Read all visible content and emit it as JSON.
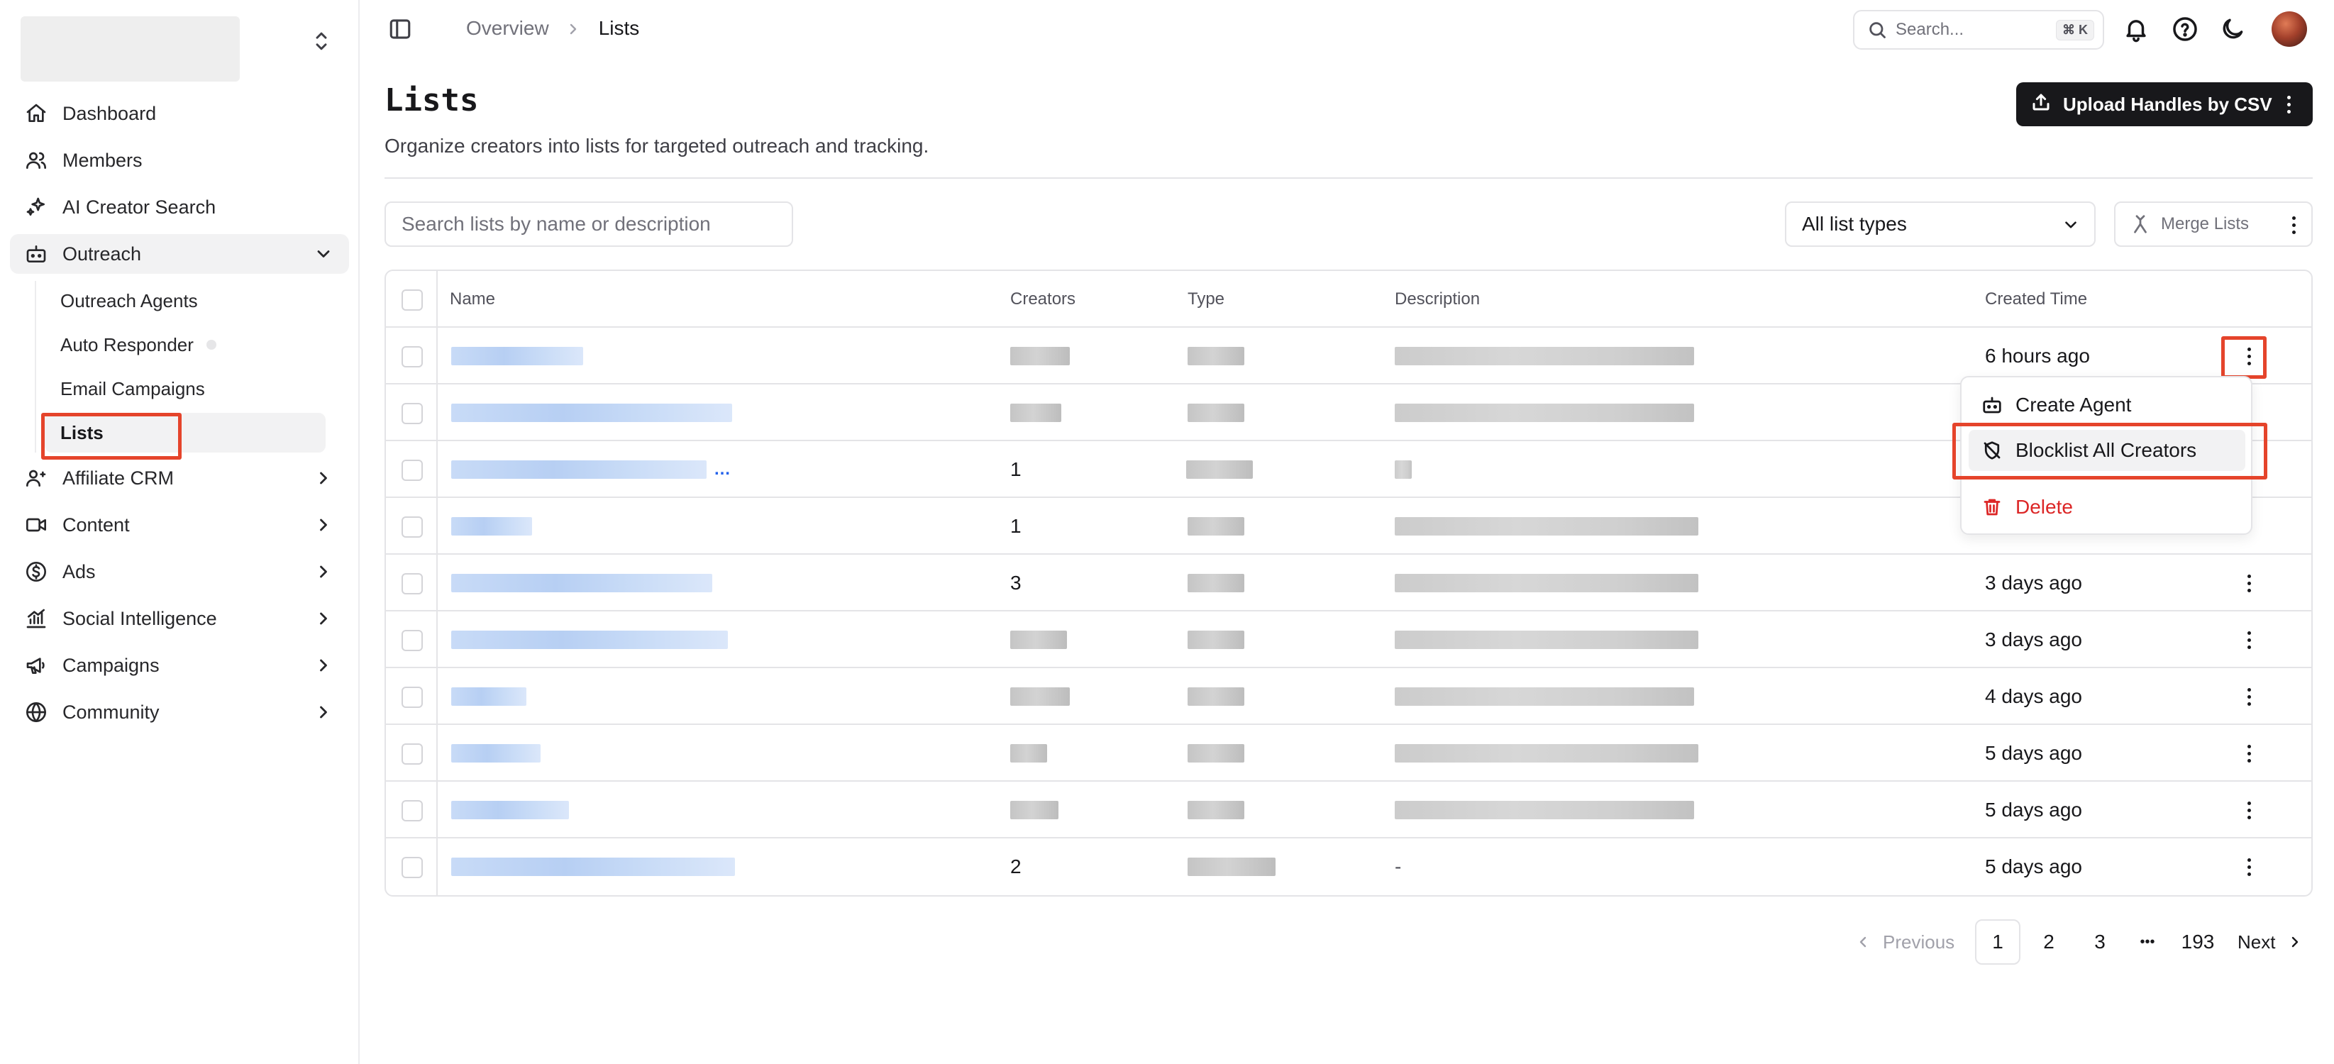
{
  "sidebar": {
    "nav": [
      {
        "label": "Dashboard",
        "icon": "home-icon"
      },
      {
        "label": "Members",
        "icon": "users-icon"
      },
      {
        "label": "AI Creator Search",
        "icon": "sparkles-icon"
      },
      {
        "label": "Outreach",
        "icon": "bot-icon"
      }
    ],
    "outreach_sub": [
      {
        "label": "Outreach Agents"
      },
      {
        "label": "Auto Responder"
      },
      {
        "label": "Email Campaigns"
      },
      {
        "label": "Lists"
      }
    ],
    "nav_more": [
      {
        "label": "Affiliate CRM",
        "icon": "user-link-icon"
      },
      {
        "label": "Content",
        "icon": "video-icon"
      },
      {
        "label": "Ads",
        "icon": "dollar-circle-icon"
      },
      {
        "label": "Social Intelligence",
        "icon": "chart-icon"
      },
      {
        "label": "Campaigns",
        "icon": "megaphone-icon"
      },
      {
        "label": "Community",
        "icon": "globe-icon"
      }
    ]
  },
  "topbar": {
    "breadcrumb": [
      "Overview",
      "Lists"
    ],
    "search_placeholder": "Search...",
    "search_shortcut": "⌘ K"
  },
  "page": {
    "title": "Lists",
    "subtitle": "Organize creators into lists for targeted outreach and tracking.",
    "upload_label": "Upload Handles by CSV",
    "search_placeholder": "Search lists by name or description",
    "type_filter": "All list types",
    "merge_label": "Merge Lists"
  },
  "table": {
    "columns": [
      "Name",
      "Creators",
      "Type",
      "Description",
      "Created Time"
    ],
    "rows": [
      {
        "creators": "",
        "created": "6 hours ago"
      },
      {
        "creators": "",
        "created": ""
      },
      {
        "creators": "1",
        "created": ""
      },
      {
        "creators": "1",
        "created": ""
      },
      {
        "creators": "3",
        "created": "3 days ago"
      },
      {
        "creators": "",
        "created": "3 days ago"
      },
      {
        "creators": "",
        "created": "4 days ago"
      },
      {
        "creators": "",
        "created": "5 days ago"
      },
      {
        "creators": "",
        "created": "5 days ago"
      },
      {
        "creators": "2",
        "description": "-",
        "created": "5 days ago"
      }
    ]
  },
  "row_menu": {
    "items": [
      "Create Agent",
      "Blocklist All Creators",
      "Delete"
    ]
  },
  "pagination": {
    "previous": "Previous",
    "pages": [
      "1",
      "2",
      "3",
      "193"
    ],
    "ellipsis": "•••",
    "next": "Next",
    "current": "1"
  },
  "colors": {
    "accent_dark": "#18181b",
    "highlight": "#e5442b",
    "danger": "#dc2626",
    "redacted_name": "#bcd1f4",
    "redacted_text": "#cccccc"
  }
}
